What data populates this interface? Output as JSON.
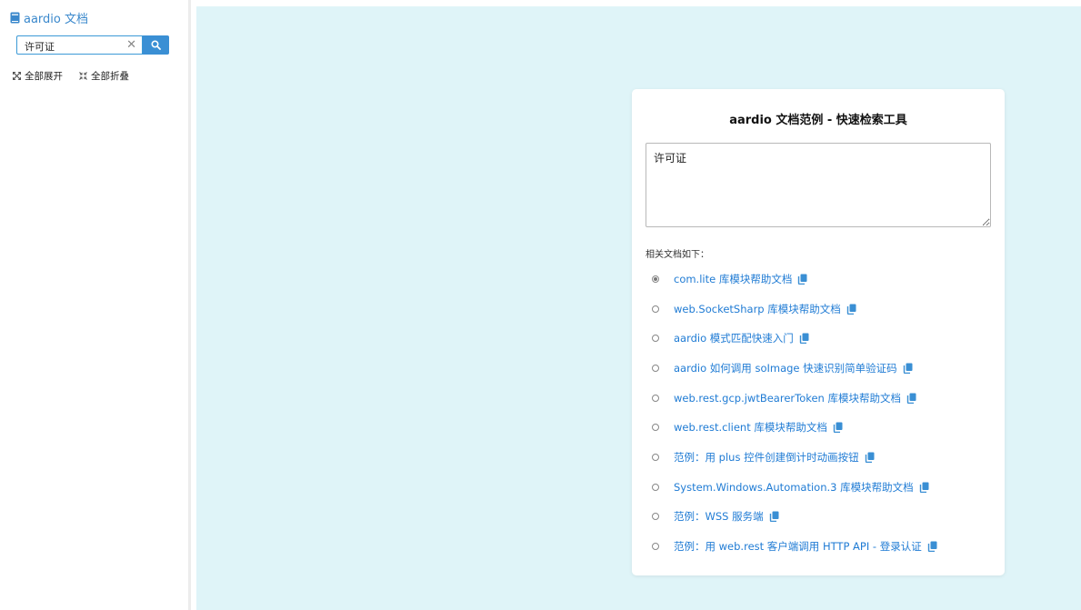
{
  "sidebar": {
    "title": "aardio 文档",
    "search": {
      "value": "许可证",
      "placeholder": ""
    },
    "expand_all": "全部展开",
    "collapse_all": "全部折叠"
  },
  "card": {
    "title": "aardio 文档范例 - 快速检索工具",
    "query": "许可证",
    "related_label": "相关文档如下：",
    "results": [
      {
        "label": "com.lite 库模块帮助文档",
        "selected": true
      },
      {
        "label": "web.SocketSharp 库模块帮助文档",
        "selected": false
      },
      {
        "label": "aardio 模式匹配快速入门",
        "selected": false
      },
      {
        "label": "aardio 如何调用 soImage 快速识别简单验证码",
        "selected": false
      },
      {
        "label": "web.rest.gcp.jwtBearerToken 库模块帮助文档",
        "selected": false
      },
      {
        "label": "web.rest.client 库模块帮助文档",
        "selected": false
      },
      {
        "label": "范例：用 plus 控件创建倒计时动画按钮",
        "selected": false
      },
      {
        "label": "System.Windows.Automation.3 库模块帮助文档",
        "selected": false
      },
      {
        "label": "范例：WSS 服务端",
        "selected": false
      },
      {
        "label": "范例：用 web.rest 客户端调用 HTTP API - 登录认证",
        "selected": false
      }
    ]
  },
  "colors": {
    "accent": "#3a8fd4",
    "link": "#1f7bd4",
    "main_background": "#dff4f8"
  },
  "icons": {
    "app": "book-icon",
    "search": "search-icon",
    "clear": "close-icon",
    "expand": "expand-icon",
    "collapse": "collapse-icon",
    "copy": "copy-icon"
  }
}
